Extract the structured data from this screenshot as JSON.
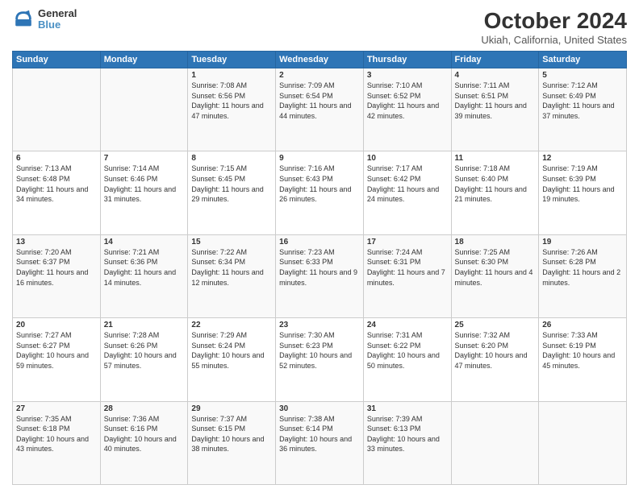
{
  "header": {
    "logo_line1": "General",
    "logo_line2": "Blue",
    "month": "October 2024",
    "location": "Ukiah, California, United States"
  },
  "weekdays": [
    "Sunday",
    "Monday",
    "Tuesday",
    "Wednesday",
    "Thursday",
    "Friday",
    "Saturday"
  ],
  "weeks": [
    [
      {
        "day": "",
        "sunrise": "",
        "sunset": "",
        "daylight": ""
      },
      {
        "day": "",
        "sunrise": "",
        "sunset": "",
        "daylight": ""
      },
      {
        "day": "1",
        "sunrise": "Sunrise: 7:08 AM",
        "sunset": "Sunset: 6:56 PM",
        "daylight": "Daylight: 11 hours and 47 minutes."
      },
      {
        "day": "2",
        "sunrise": "Sunrise: 7:09 AM",
        "sunset": "Sunset: 6:54 PM",
        "daylight": "Daylight: 11 hours and 44 minutes."
      },
      {
        "day": "3",
        "sunrise": "Sunrise: 7:10 AM",
        "sunset": "Sunset: 6:52 PM",
        "daylight": "Daylight: 11 hours and 42 minutes."
      },
      {
        "day": "4",
        "sunrise": "Sunrise: 7:11 AM",
        "sunset": "Sunset: 6:51 PM",
        "daylight": "Daylight: 11 hours and 39 minutes."
      },
      {
        "day": "5",
        "sunrise": "Sunrise: 7:12 AM",
        "sunset": "Sunset: 6:49 PM",
        "daylight": "Daylight: 11 hours and 37 minutes."
      }
    ],
    [
      {
        "day": "6",
        "sunrise": "Sunrise: 7:13 AM",
        "sunset": "Sunset: 6:48 PM",
        "daylight": "Daylight: 11 hours and 34 minutes."
      },
      {
        "day": "7",
        "sunrise": "Sunrise: 7:14 AM",
        "sunset": "Sunset: 6:46 PM",
        "daylight": "Daylight: 11 hours and 31 minutes."
      },
      {
        "day": "8",
        "sunrise": "Sunrise: 7:15 AM",
        "sunset": "Sunset: 6:45 PM",
        "daylight": "Daylight: 11 hours and 29 minutes."
      },
      {
        "day": "9",
        "sunrise": "Sunrise: 7:16 AM",
        "sunset": "Sunset: 6:43 PM",
        "daylight": "Daylight: 11 hours and 26 minutes."
      },
      {
        "day": "10",
        "sunrise": "Sunrise: 7:17 AM",
        "sunset": "Sunset: 6:42 PM",
        "daylight": "Daylight: 11 hours and 24 minutes."
      },
      {
        "day": "11",
        "sunrise": "Sunrise: 7:18 AM",
        "sunset": "Sunset: 6:40 PM",
        "daylight": "Daylight: 11 hours and 21 minutes."
      },
      {
        "day": "12",
        "sunrise": "Sunrise: 7:19 AM",
        "sunset": "Sunset: 6:39 PM",
        "daylight": "Daylight: 11 hours and 19 minutes."
      }
    ],
    [
      {
        "day": "13",
        "sunrise": "Sunrise: 7:20 AM",
        "sunset": "Sunset: 6:37 PM",
        "daylight": "Daylight: 11 hours and 16 minutes."
      },
      {
        "day": "14",
        "sunrise": "Sunrise: 7:21 AM",
        "sunset": "Sunset: 6:36 PM",
        "daylight": "Daylight: 11 hours and 14 minutes."
      },
      {
        "day": "15",
        "sunrise": "Sunrise: 7:22 AM",
        "sunset": "Sunset: 6:34 PM",
        "daylight": "Daylight: 11 hours and 12 minutes."
      },
      {
        "day": "16",
        "sunrise": "Sunrise: 7:23 AM",
        "sunset": "Sunset: 6:33 PM",
        "daylight": "Daylight: 11 hours and 9 minutes."
      },
      {
        "day": "17",
        "sunrise": "Sunrise: 7:24 AM",
        "sunset": "Sunset: 6:31 PM",
        "daylight": "Daylight: 11 hours and 7 minutes."
      },
      {
        "day": "18",
        "sunrise": "Sunrise: 7:25 AM",
        "sunset": "Sunset: 6:30 PM",
        "daylight": "Daylight: 11 hours and 4 minutes."
      },
      {
        "day": "19",
        "sunrise": "Sunrise: 7:26 AM",
        "sunset": "Sunset: 6:28 PM",
        "daylight": "Daylight: 11 hours and 2 minutes."
      }
    ],
    [
      {
        "day": "20",
        "sunrise": "Sunrise: 7:27 AM",
        "sunset": "Sunset: 6:27 PM",
        "daylight": "Daylight: 10 hours and 59 minutes."
      },
      {
        "day": "21",
        "sunrise": "Sunrise: 7:28 AM",
        "sunset": "Sunset: 6:26 PM",
        "daylight": "Daylight: 10 hours and 57 minutes."
      },
      {
        "day": "22",
        "sunrise": "Sunrise: 7:29 AM",
        "sunset": "Sunset: 6:24 PM",
        "daylight": "Daylight: 10 hours and 55 minutes."
      },
      {
        "day": "23",
        "sunrise": "Sunrise: 7:30 AM",
        "sunset": "Sunset: 6:23 PM",
        "daylight": "Daylight: 10 hours and 52 minutes."
      },
      {
        "day": "24",
        "sunrise": "Sunrise: 7:31 AM",
        "sunset": "Sunset: 6:22 PM",
        "daylight": "Daylight: 10 hours and 50 minutes."
      },
      {
        "day": "25",
        "sunrise": "Sunrise: 7:32 AM",
        "sunset": "Sunset: 6:20 PM",
        "daylight": "Daylight: 10 hours and 47 minutes."
      },
      {
        "day": "26",
        "sunrise": "Sunrise: 7:33 AM",
        "sunset": "Sunset: 6:19 PM",
        "daylight": "Daylight: 10 hours and 45 minutes."
      }
    ],
    [
      {
        "day": "27",
        "sunrise": "Sunrise: 7:35 AM",
        "sunset": "Sunset: 6:18 PM",
        "daylight": "Daylight: 10 hours and 43 minutes."
      },
      {
        "day": "28",
        "sunrise": "Sunrise: 7:36 AM",
        "sunset": "Sunset: 6:16 PM",
        "daylight": "Daylight: 10 hours and 40 minutes."
      },
      {
        "day": "29",
        "sunrise": "Sunrise: 7:37 AM",
        "sunset": "Sunset: 6:15 PM",
        "daylight": "Daylight: 10 hours and 38 minutes."
      },
      {
        "day": "30",
        "sunrise": "Sunrise: 7:38 AM",
        "sunset": "Sunset: 6:14 PM",
        "daylight": "Daylight: 10 hours and 36 minutes."
      },
      {
        "day": "31",
        "sunrise": "Sunrise: 7:39 AM",
        "sunset": "Sunset: 6:13 PM",
        "daylight": "Daylight: 10 hours and 33 minutes."
      },
      {
        "day": "",
        "sunrise": "",
        "sunset": "",
        "daylight": ""
      },
      {
        "day": "",
        "sunrise": "",
        "sunset": "",
        "daylight": ""
      }
    ]
  ]
}
